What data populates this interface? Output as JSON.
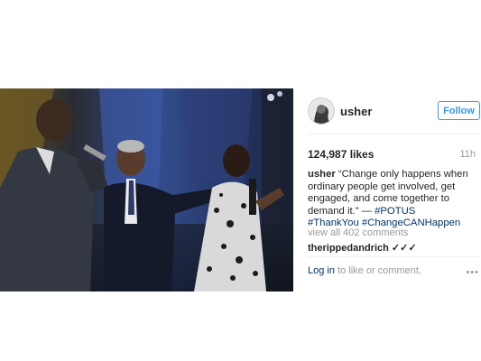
{
  "post": {
    "username": "usher",
    "follow_label": "Follow",
    "likes": "124,987 likes",
    "time_ago": "11h",
    "caption": {
      "user": "usher",
      "text": "“Change only happens when ordinary people get involved, get engaged, and come together to demand it.” — ",
      "hashtags": [
        "#POTUS",
        "#ThankYou",
        "#ChangeCANHappen"
      ]
    },
    "view_comments": "view all 402 comments",
    "first_comment_user": "therippedandrich ✓✓✓",
    "login_link": "Log in",
    "login_rest": " to like or comment.",
    "more_label": "•••",
    "photo_icon": "photo-image",
    "colors": {
      "link": "#3897f0",
      "hashtag": "#003569",
      "muted": "#999999"
    }
  }
}
